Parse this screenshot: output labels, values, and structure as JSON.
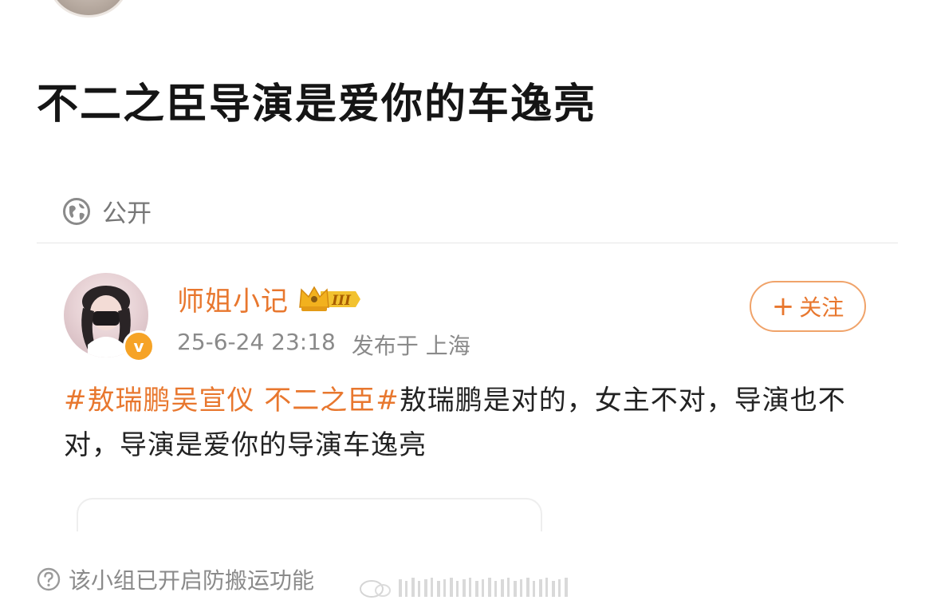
{
  "post": {
    "title": "不二之臣导演是爱你的车逸亮",
    "visibility_label": "公开"
  },
  "embedded_weibo": {
    "author_name": "师姐小记",
    "vip_level": "III",
    "verified_mark": "v",
    "timestamp": "25-6-24 23:18",
    "location": "发布于 上海",
    "follow_plus": "+",
    "follow_label": "关注",
    "hashtag": "#敖瑞鹏吴宣仪 不二之臣#",
    "body": "敖瑞鹏是对的，女主不对，导演也不对，导演是爱你的导演车逸亮"
  },
  "footer": {
    "note": "该小组已开启防搬运功能"
  },
  "icons": {
    "visibility": "globe-icon",
    "footer": "question-circle-icon",
    "vip": "crown-icon"
  },
  "colors": {
    "accent": "#e8772e",
    "muted": "#8a8a8a",
    "verified": "#f6a326",
    "vip_gold": "#f2c230"
  }
}
